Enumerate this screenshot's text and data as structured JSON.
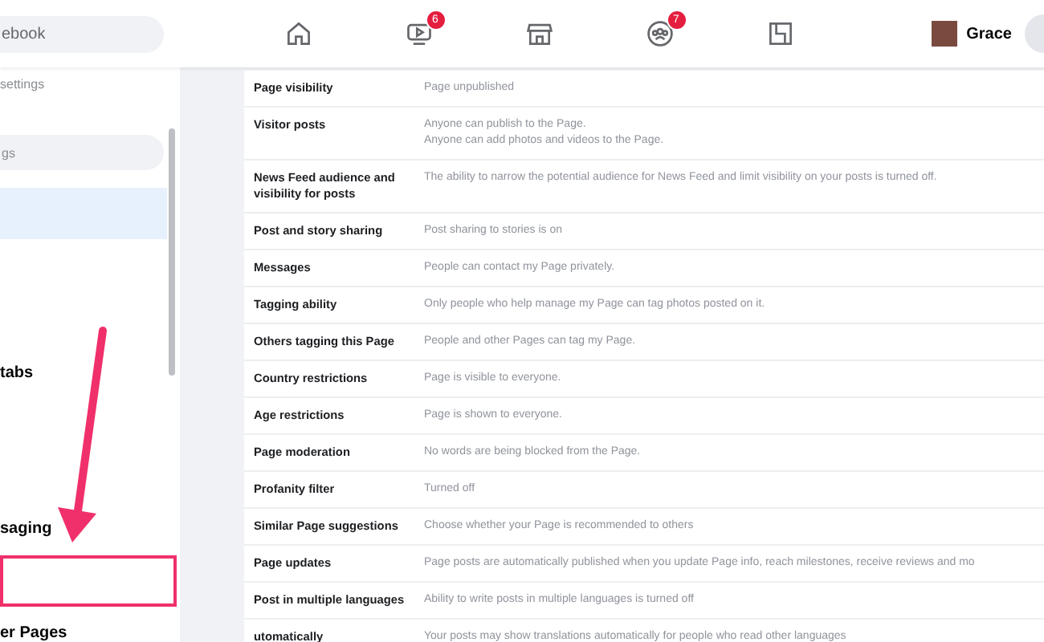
{
  "header": {
    "search": {
      "value": "ebook"
    },
    "nav": [
      {
        "kind": "home",
        "selected": false
      },
      {
        "kind": "watch",
        "selected": false,
        "badge": "6"
      },
      {
        "kind": "marketplace",
        "selected": false
      },
      {
        "kind": "groups",
        "selected": false,
        "badge": "7"
      },
      {
        "kind": "gaming",
        "selected": false
      }
    ],
    "profile": {
      "name": "Grace"
    }
  },
  "sidebar": {
    "heading": "settings",
    "search": {
      "placeholder": "gs"
    },
    "items": [
      {
        "selected": true
      },
      {
        "label": "tabs",
        "selected": false
      },
      {
        "label": "saging",
        "selected": false
      },
      {
        "selected": false,
        "highlighted": true
      },
      {
        "label": "er Pages",
        "selected": false
      }
    ]
  },
  "settings": [
    {
      "label": "Page visibility",
      "values": [
        "Page unpublished"
      ]
    },
    {
      "label": "Visitor posts",
      "values": [
        "Anyone can publish to the Page.",
        "Anyone can add photos and videos to the Page."
      ]
    },
    {
      "label": "News Feed audience and visibility for posts",
      "values": [
        "The ability to narrow the potential audience for News Feed and limit visibility on your posts is turned off."
      ]
    },
    {
      "label": "Post and story sharing",
      "values": [
        "Post sharing to stories is on"
      ]
    },
    {
      "label": "Messages",
      "values": [
        "People can contact my Page privately."
      ]
    },
    {
      "label": "Tagging ability",
      "values": [
        "Only people who help manage my Page can tag photos posted on it."
      ]
    },
    {
      "label": "Others tagging this Page",
      "values": [
        "People and other Pages can tag my Page."
      ]
    },
    {
      "label": "Country restrictions",
      "values": [
        "Page is visible to everyone."
      ]
    },
    {
      "label": "Age restrictions",
      "values": [
        "Page is shown to everyone."
      ]
    },
    {
      "label": "Page moderation",
      "values": [
        "No words are being blocked from the Page."
      ]
    },
    {
      "label": "Profanity filter",
      "values": [
        "Turned off"
      ]
    },
    {
      "label": "Similar Page suggestions",
      "values": [
        "Choose whether your Page is recommended to others"
      ]
    },
    {
      "label": "Page updates",
      "values": [
        "Page posts are automatically published when you update Page info, reach milestones, receive reviews and mo"
      ]
    },
    {
      "label": "Post in multiple languages",
      "values": [
        "Ability to write posts in multiple languages is turned off"
      ]
    },
    {
      "label": "utomatically",
      "values": [
        "Your posts may show translations automatically for people who read other languages"
      ]
    }
  ]
}
